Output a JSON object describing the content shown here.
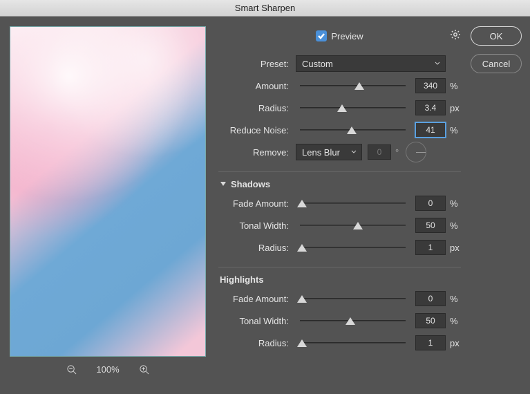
{
  "window": {
    "title": "Smart Sharpen"
  },
  "preview": {
    "label": "Preview",
    "checked": true
  },
  "zoom": {
    "level": "100%"
  },
  "preset": {
    "label": "Preset:",
    "value": "Custom"
  },
  "main": {
    "amount": {
      "label": "Amount:",
      "value": "340",
      "unit": "%",
      "pos": 56
    },
    "radius": {
      "label": "Radius:",
      "value": "3.4",
      "unit": "px",
      "pos": 40
    },
    "reduceNoise": {
      "label": "Reduce Noise:",
      "value": "41",
      "unit": "%",
      "pos": 49
    },
    "remove": {
      "label": "Remove:",
      "value": "Lens Blur",
      "angle": "0"
    }
  },
  "shadows": {
    "title": "Shadows",
    "fadeAmount": {
      "label": "Fade Amount:",
      "value": "0",
      "unit": "%",
      "pos": 2
    },
    "tonalWidth": {
      "label": "Tonal Width:",
      "value": "50",
      "unit": "%",
      "pos": 55
    },
    "radius": {
      "label": "Radius:",
      "value": "1",
      "unit": "px",
      "pos": 2
    }
  },
  "highlights": {
    "title": "Highlights",
    "fadeAmount": {
      "label": "Fade Amount:",
      "value": "0",
      "unit": "%",
      "pos": 2
    },
    "tonalWidth": {
      "label": "Tonal Width:",
      "value": "50",
      "unit": "%",
      "pos": 48
    },
    "radius": {
      "label": "Radius:",
      "value": "1",
      "unit": "px",
      "pos": 2
    }
  },
  "buttons": {
    "ok": "OK",
    "cancel": "Cancel"
  }
}
